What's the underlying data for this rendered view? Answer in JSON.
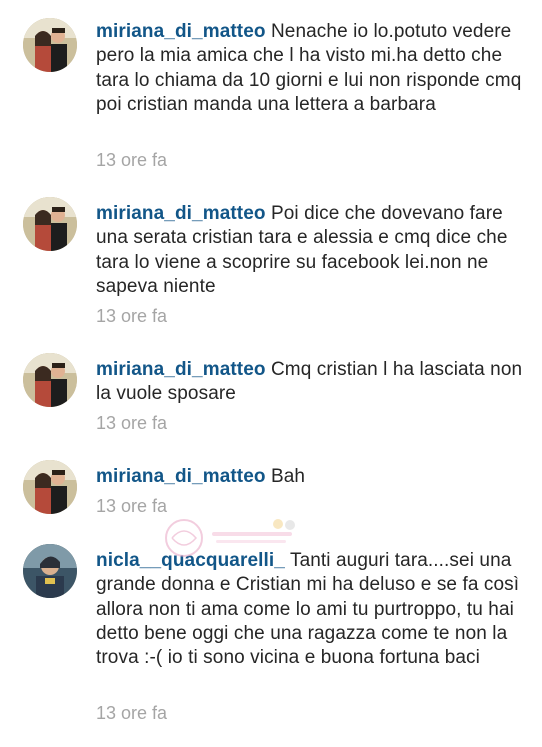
{
  "comments": [
    {
      "username": "miriana_di_matteo",
      "text": "Nenache io lo.potuto vedere pero la mia amica che l ha visto mi.ha detto che tara lo chiama da 10 giorni e lui non risponde cmq poi cristian manda una lettera  a barbara",
      "time": "13 ore fa",
      "avatar": "couple-photo"
    },
    {
      "username": "miriana_di_matteo",
      "text": "Poi dice che dovevano fare una serata cristian tara e alessia e cmq dice che tara lo viene a scoprire su facebook lei.non ne sapeva niente",
      "time": "13 ore fa",
      "avatar": "couple-photo"
    },
    {
      "username": "miriana_di_matteo",
      "text": "Cmq cristian l ha lasciata non la vuole sposare",
      "time": "13 ore fa",
      "avatar": "couple-photo"
    },
    {
      "username": "miriana_di_matteo",
      "text": "Bah",
      "time": "13 ore fa",
      "avatar": "couple-photo"
    },
    {
      "username": "nicla__quacquarelli_",
      "text": "Tanti auguri tara....sei una grande donna  e Cristian mi ha deluso e se fa così allora non ti ama come lo ami tu purtroppo, tu hai detto bene oggi che una ragazza come  te non la trova :-( io ti sono  vicina  e buona  fortuna baci",
      "time": "13 ore fa",
      "avatar": "person-photo"
    }
  ],
  "colors": {
    "username": "#125688",
    "text": "#262626",
    "timestamp": "#a5a5a5",
    "background": "#ffffff"
  }
}
